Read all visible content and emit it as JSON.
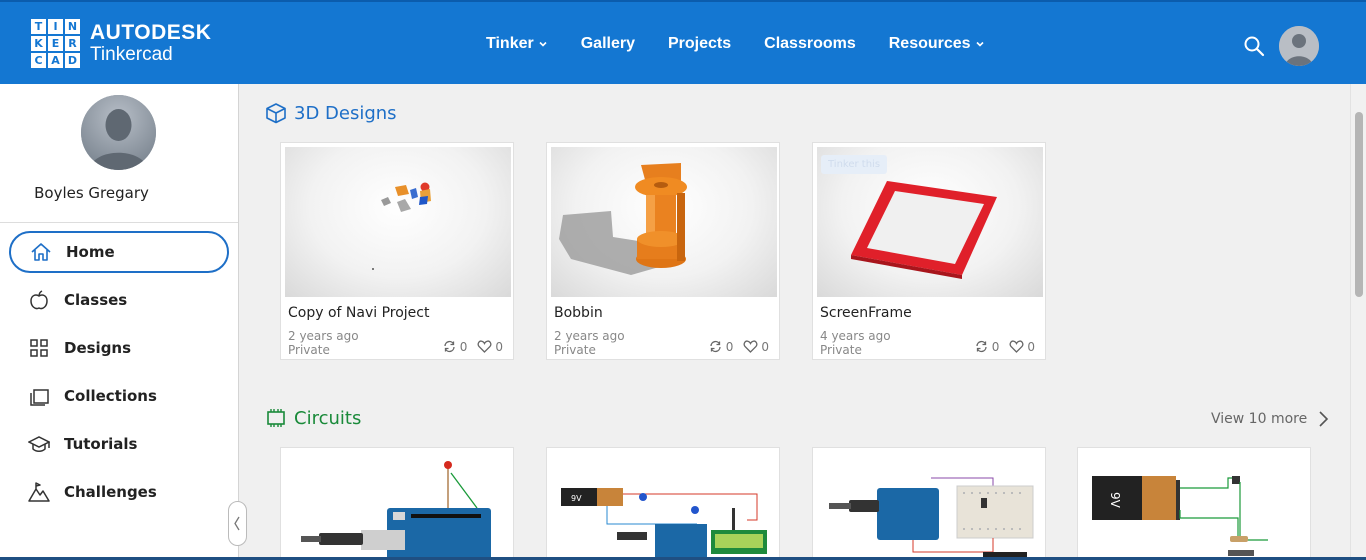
{
  "header": {
    "logo_letters": [
      "T",
      "I",
      "N",
      "K",
      "E",
      "R",
      "C",
      "A",
      "D"
    ],
    "brand": "AUTODESK",
    "product": "Tinkercad",
    "nav": [
      {
        "label": "Tinker",
        "dropdown": true
      },
      {
        "label": "Gallery",
        "dropdown": false
      },
      {
        "label": "Projects",
        "dropdown": false
      },
      {
        "label": "Classrooms",
        "dropdown": false
      },
      {
        "label": "Resources",
        "dropdown": true
      }
    ],
    "search_icon": "search-icon",
    "avatar_icon": "user-avatar-icon"
  },
  "sidebar": {
    "profile_name": "Boyles Gregary",
    "items": [
      {
        "label": "Home",
        "icon": "home-icon",
        "active": true
      },
      {
        "label": "Classes",
        "icon": "apple-icon",
        "active": false
      },
      {
        "label": "Designs",
        "icon": "grid-icon",
        "active": false
      },
      {
        "label": "Collections",
        "icon": "folders-icon",
        "active": false
      },
      {
        "label": "Tutorials",
        "icon": "graduation-cap-icon",
        "active": false
      },
      {
        "label": "Challenges",
        "icon": "mountain-icon",
        "active": false
      }
    ]
  },
  "designs": {
    "title": "3D Designs",
    "cards": [
      {
        "title": "Copy of Navi Project",
        "age": "2 years ago",
        "visibility": "Private",
        "remixes": "0",
        "likes": "0"
      },
      {
        "title": "Bobbin",
        "age": "2 years ago",
        "visibility": "Private",
        "remixes": "0",
        "likes": "0"
      },
      {
        "title": "ScreenFrame",
        "age": "4 years ago",
        "visibility": "Private",
        "remixes": "0",
        "likes": "0",
        "badge": "Tinker this"
      }
    ]
  },
  "circuits": {
    "title": "Circuits",
    "view_more": "View 10 more",
    "battery_label": "9V"
  },
  "colors": {
    "header_bg": "#1477d2",
    "designs_accent": "#1e6fc7",
    "circuits_accent": "#1a8a3a",
    "active_outline": "#1e6fc7"
  }
}
